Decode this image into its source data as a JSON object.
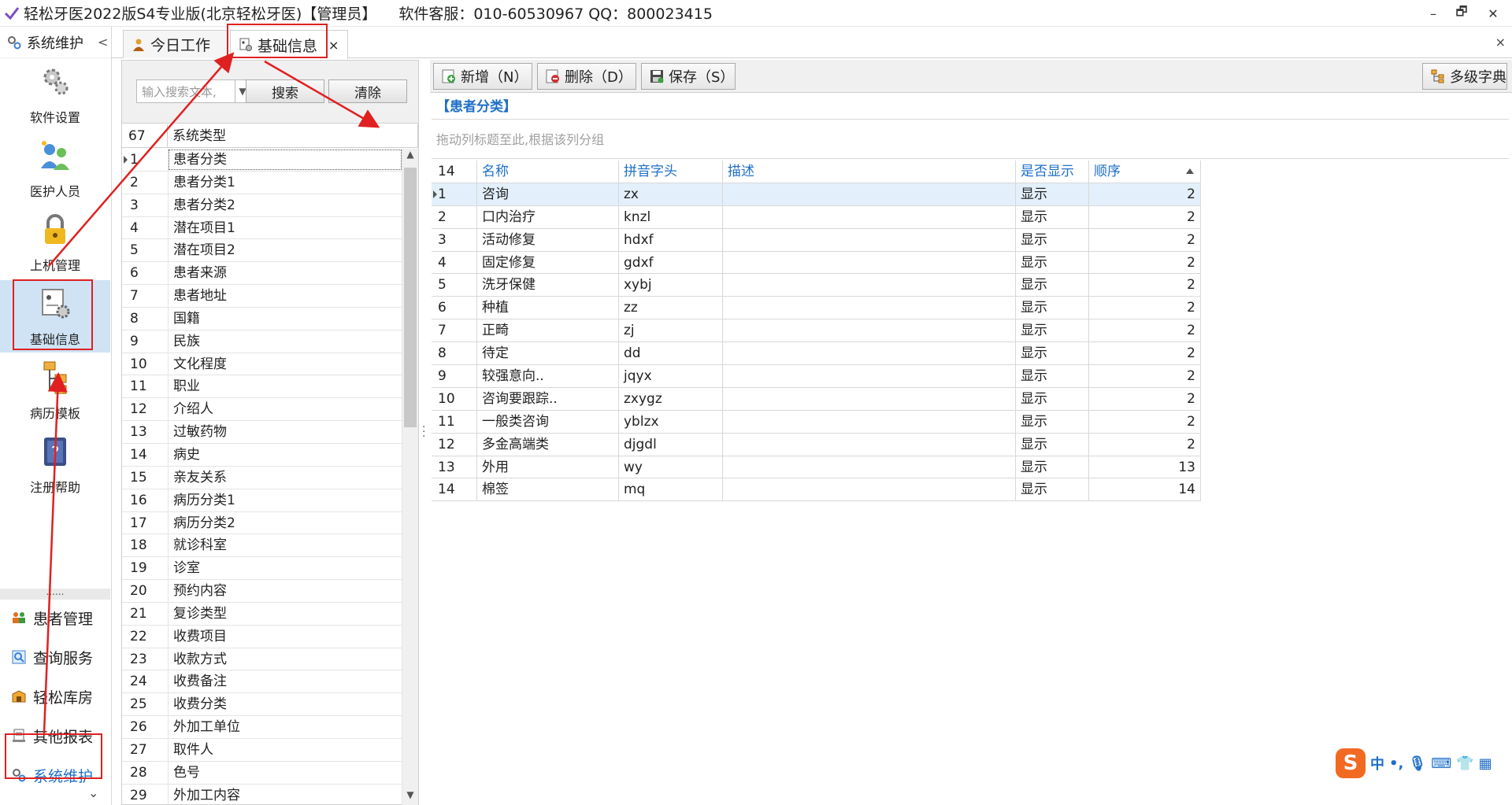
{
  "titlebar": {
    "title": "轻松牙医2022版S4专业版(北京轻松牙医)【管理员】",
    "support": "软件客服：010-60530967 QQ：800023415",
    "min_label": "–",
    "restore_label": "🗗",
    "close_label": "✕"
  },
  "leftnav": {
    "header": "系统维护",
    "header_chevron": "<",
    "big_items": [
      {
        "label": "软件设置",
        "icon": "gear-icon"
      },
      {
        "label": "医护人员",
        "icon": "staff-icon"
      },
      {
        "label": "上机管理",
        "icon": "lock-icon"
      },
      {
        "label": "基础信息",
        "icon": "info-settings-icon"
      },
      {
        "label": "病历模板",
        "icon": "template-icon"
      },
      {
        "label": "注册帮助",
        "icon": "help-book-icon"
      }
    ],
    "dots": "......",
    "small_items": [
      {
        "label": "患者管理",
        "icon": "patients-icon"
      },
      {
        "label": "查询服务",
        "icon": "search-icon"
      },
      {
        "label": "轻松库房",
        "icon": "warehouse-icon"
      },
      {
        "label": "其他报表",
        "icon": "report-icon"
      },
      {
        "label": "系统维护",
        "icon": "gear-icon"
      }
    ],
    "down_chevron": "⌄"
  },
  "tabs": {
    "items": [
      {
        "label": "今日工作"
      },
      {
        "label": "基础信息",
        "close": "×"
      }
    ],
    "close_all": "×"
  },
  "middle": {
    "search_placeholder": "输入搜索文本,",
    "search_button": "搜索",
    "clear_button": "清除",
    "count": "67",
    "column": "系统类型",
    "items": [
      {
        "idx": "1",
        "name": "患者分类"
      },
      {
        "idx": "2",
        "name": "患者分类1"
      },
      {
        "idx": "3",
        "name": "患者分类2"
      },
      {
        "idx": "4",
        "name": "潜在项目1"
      },
      {
        "idx": "5",
        "name": "潜在项目2"
      },
      {
        "idx": "6",
        "name": "患者来源"
      },
      {
        "idx": "7",
        "name": "患者地址"
      },
      {
        "idx": "8",
        "name": "国籍"
      },
      {
        "idx": "9",
        "name": "民族"
      },
      {
        "idx": "10",
        "name": "文化程度"
      },
      {
        "idx": "11",
        "name": "职业"
      },
      {
        "idx": "12",
        "name": "介绍人"
      },
      {
        "idx": "13",
        "name": "过敏药物"
      },
      {
        "idx": "14",
        "name": "病史"
      },
      {
        "idx": "15",
        "name": "亲友关系"
      },
      {
        "idx": "16",
        "name": "病历分类1"
      },
      {
        "idx": "17",
        "name": "病历分类2"
      },
      {
        "idx": "18",
        "name": "就诊科室"
      },
      {
        "idx": "19",
        "name": "诊室"
      },
      {
        "idx": "20",
        "name": "预约内容"
      },
      {
        "idx": "21",
        "name": "复诊类型"
      },
      {
        "idx": "22",
        "name": "收费项目"
      },
      {
        "idx": "23",
        "name": "收款方式"
      },
      {
        "idx": "24",
        "name": "收费备注"
      },
      {
        "idx": "25",
        "name": "收费分类"
      },
      {
        "idx": "26",
        "name": "外加工单位"
      },
      {
        "idx": "27",
        "name": "取件人"
      },
      {
        "idx": "28",
        "name": "色号"
      },
      {
        "idx": "29",
        "name": "外加工内容"
      }
    ]
  },
  "toolbar": {
    "add": "新增（N）",
    "delete": "删除（D）",
    "save": "保存（S）",
    "multi_dict": "多级字典"
  },
  "grid": {
    "title": "【患者分类】",
    "group_hint": "拖动列标题至此,根据该列分组",
    "count": "14",
    "headers": [
      "名称",
      "拼音字头",
      "描述",
      "是否显示",
      "顺序"
    ],
    "rows": [
      {
        "idx": "1",
        "name": "咨询",
        "py": "zx",
        "desc": "",
        "show": "显示",
        "order": "2"
      },
      {
        "idx": "2",
        "name": "口内治疗",
        "py": "knzl",
        "desc": "",
        "show": "显示",
        "order": "2"
      },
      {
        "idx": "3",
        "name": "活动修复",
        "py": "hdxf",
        "desc": "",
        "show": "显示",
        "order": "2"
      },
      {
        "idx": "4",
        "name": "固定修复",
        "py": "gdxf",
        "desc": "",
        "show": "显示",
        "order": "2"
      },
      {
        "idx": "5",
        "name": "洗牙保健",
        "py": "xybj",
        "desc": "",
        "show": "显示",
        "order": "2"
      },
      {
        "idx": "6",
        "name": "种植",
        "py": "zz",
        "desc": "",
        "show": "显示",
        "order": "2"
      },
      {
        "idx": "7",
        "name": "正畸",
        "py": "zj",
        "desc": "",
        "show": "显示",
        "order": "2"
      },
      {
        "idx": "8",
        "name": "待定",
        "py": "dd",
        "desc": "",
        "show": "显示",
        "order": "2"
      },
      {
        "idx": "9",
        "name": "较强意向..",
        "py": "jqyx",
        "desc": "",
        "show": "显示",
        "order": "2"
      },
      {
        "idx": "10",
        "name": "咨询要跟踪..",
        "py": "zxygz",
        "desc": "",
        "show": "显示",
        "order": "2"
      },
      {
        "idx": "11",
        "name": "一般类咨询",
        "py": "yblzx",
        "desc": "",
        "show": "显示",
        "order": "2"
      },
      {
        "idx": "12",
        "name": "多金高端类",
        "py": "djgdl",
        "desc": "",
        "show": "显示",
        "order": "2"
      },
      {
        "idx": "13",
        "name": "外用",
        "py": "wy",
        "desc": "",
        "show": "显示",
        "order": "13"
      },
      {
        "idx": "14",
        "name": "棉签",
        "py": "mq",
        "desc": "",
        "show": "显示",
        "order": "14"
      }
    ]
  },
  "ime": {
    "logo": "S",
    "mode": "中",
    "punct": "•,",
    "mic": "🎙",
    "keyboard": "⌨",
    "skin": "👕",
    "menu": "▦"
  },
  "colors": {
    "accent": "#1e6fc8",
    "annotation_red": "#e02020",
    "nav_active_bg": "#cfe3f5",
    "ime_orange": "#f26a22"
  }
}
